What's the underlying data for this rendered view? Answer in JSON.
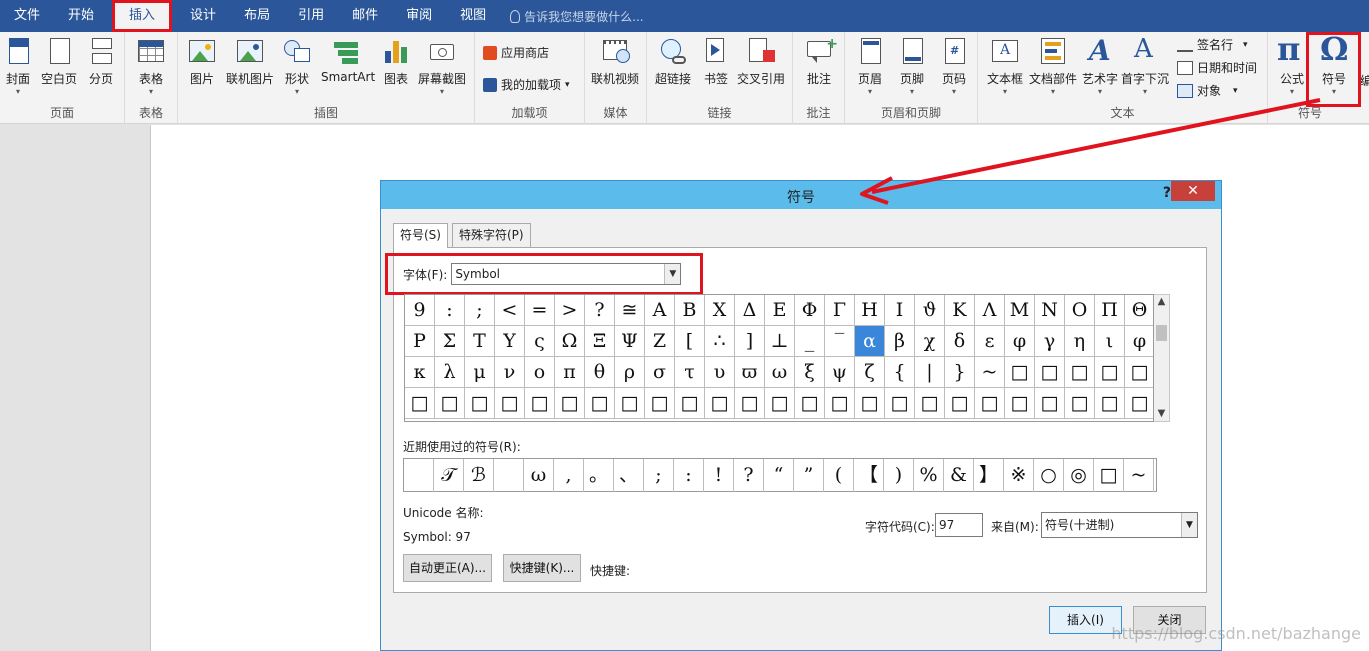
{
  "menu": {
    "tabs": [
      "文件",
      "开始",
      "插入",
      "设计",
      "布局",
      "引用",
      "邮件",
      "审阅",
      "视图"
    ],
    "active_tab": "插入",
    "tell_me": "告诉我您想要做什么..."
  },
  "ribbon": {
    "groups": {
      "pages": "页面",
      "tables": "表格",
      "illustrations": "插图",
      "addins": "加载项",
      "media": "媒体",
      "links": "链接",
      "comments": "批注",
      "header_footer": "页眉和页脚",
      "text": "文本",
      "symbols": "符号"
    },
    "buttons": {
      "cover": "封面",
      "blank_page": "空白页",
      "page_break": "分页",
      "table": "表格",
      "picture": "图片",
      "online_picture": "联机图片",
      "shapes": "形状",
      "smartart": "SmartArt",
      "chart": "图表",
      "screenshot": "屏幕截图",
      "store": "应用商店",
      "my_addins": "我的加载项",
      "online_video": "联机视频",
      "hyperlink": "超链接",
      "bookmark": "书签",
      "cross_ref": "交叉引用",
      "comment": "批注",
      "header": "页眉",
      "footer": "页脚",
      "page_number": "页码",
      "textbox": "文本框",
      "quick_parts": "文档部件",
      "wordart": "艺术字",
      "dropcap": "首字下沉",
      "signature": "签名行",
      "datetime": "日期和时间",
      "object": "对象",
      "equation": "公式",
      "symbol": "符号",
      "cut_off": "编"
    }
  },
  "dialog": {
    "title": "符号",
    "help": "?",
    "close": "✕",
    "tabs": {
      "symbols": "符号(S)",
      "special": "特殊字符(P)"
    },
    "font_label": "字体(F):",
    "font_value": "Symbol",
    "symbol_rows": [
      [
        "9",
        ":",
        ";",
        "<",
        "=",
        ">",
        "?",
        "≅",
        "Α",
        "Β",
        "Χ",
        "Δ",
        "Ε",
        "Φ",
        "Γ",
        "Η",
        "Ι",
        "ϑ",
        "Κ",
        "Λ",
        "Μ",
        "Ν",
        "Ο",
        "Π",
        "Θ"
      ],
      [
        "Ρ",
        "Σ",
        "Τ",
        "Υ",
        "ς",
        "Ω",
        "Ξ",
        "Ψ",
        "Ζ",
        "[",
        "∴",
        "]",
        "⊥",
        "_",
        "‾",
        "α",
        "β",
        "χ",
        "δ",
        "ε",
        "φ",
        "γ",
        "η",
        "ι",
        "φ"
      ],
      [
        "κ",
        "λ",
        "μ",
        "ν",
        "ο",
        "π",
        "θ",
        "ρ",
        "σ",
        "τ",
        "υ",
        "ϖ",
        "ω",
        "ξ",
        "ψ",
        "ζ",
        "{",
        "|",
        "}",
        "~",
        "□",
        "□",
        "□",
        "□",
        "□"
      ],
      [
        "□",
        "□",
        "□",
        "□",
        "□",
        "□",
        "□",
        "□",
        "□",
        "□",
        "□",
        "□",
        "□",
        "□",
        "□",
        "□",
        "□",
        "□",
        "□",
        "□",
        "□",
        "□",
        "□",
        "□",
        "□"
      ]
    ],
    "selected_symbol": "α",
    "recent_label": "近期使用过的符号(R):",
    "recent_symbols": [
      "",
      "𝒯",
      "ℬ",
      "",
      "ω",
      ",",
      "。",
      "、",
      ";",
      ":",
      "!",
      "?",
      "“",
      "”",
      "(",
      "【",
      ")",
      "%",
      "&",
      "】",
      "※",
      "○",
      "◎",
      "□",
      "~"
    ],
    "unicode_name_label": "Unicode 名称:",
    "unicode_value": "Symbol: 97",
    "char_code_label": "字符代码(C):",
    "char_code_value": "97",
    "from_label": "来自(M):",
    "from_value": "符号(十进制)",
    "autocorrect_btn": "自动更正(A)...",
    "shortcut_btn": "快捷键(K)...",
    "shortcut_label": "快捷键:",
    "insert_btn": "插入(I)",
    "close_btn": "关闭"
  },
  "watermark": "https://blog.csdn.net/bazhange",
  "colors": {
    "accent": "#2b579a",
    "highlight": "#e0141e",
    "titlebar": "#5bbbea",
    "selected": "#3a86d8"
  }
}
